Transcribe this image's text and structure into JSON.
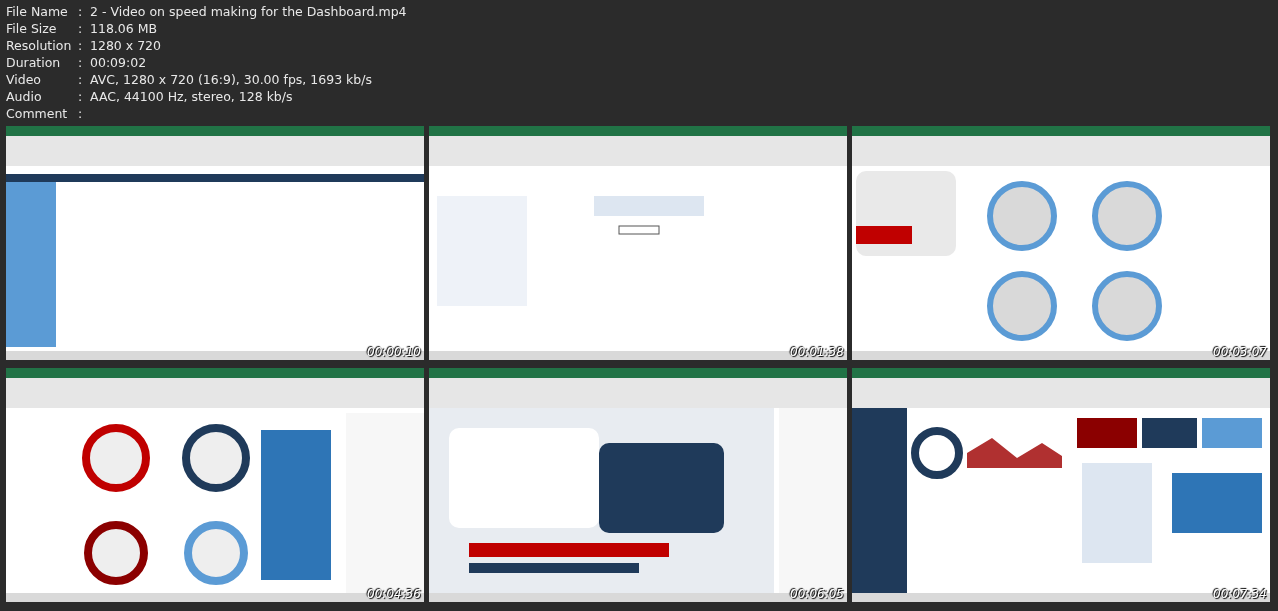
{
  "info": [
    {
      "label": "File Name",
      "separator": ":",
      "value": "2 - Video on speed making for the Dashboard.mp4"
    },
    {
      "label": "File Size",
      "separator": ":",
      "value": "118.06 MB"
    },
    {
      "label": "Resolution",
      "separator": ":",
      "value": "1280 x 720"
    },
    {
      "label": "Duration",
      "separator": ":",
      "value": "00:09:02"
    },
    {
      "label": "Video",
      "separator": ":",
      "value": "AVC, 1280 x 720 (16:9), 30.00 fps, 1693 kb/s"
    },
    {
      "label": "Audio",
      "separator": ":",
      "value": "AAC, 44100 Hz, stereo, 128 kb/s"
    },
    {
      "label": "Comment",
      "separator": ":"
    }
  ],
  "thumbnails": [
    {
      "kind": "picture",
      "timestamp": "00:00:10"
    },
    {
      "kind": "picture",
      "timestamp": "00:01:38"
    },
    {
      "kind": "picture",
      "timestamp": "00:03:07"
    },
    {
      "kind": "picture",
      "timestamp": "00:04:36"
    },
    {
      "kind": "picture",
      "timestamp": "00:06:05"
    },
    {
      "kind": "picture",
      "timestamp": "00:07:34"
    }
  ]
}
